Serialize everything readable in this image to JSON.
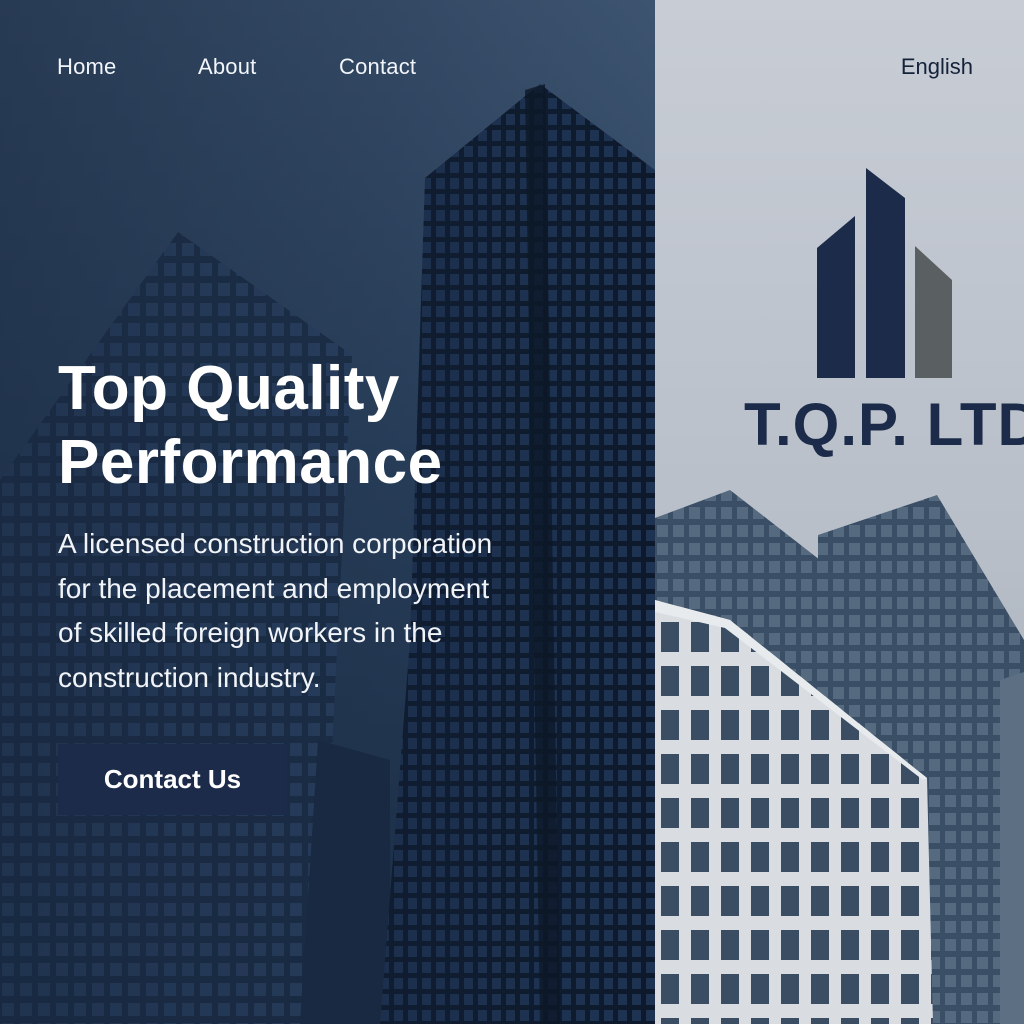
{
  "nav": {
    "links": [
      "Home",
      "About",
      "Contact"
    ],
    "language": "English"
  },
  "hero": {
    "title_line1": "Top Quality",
    "title_line2": "Performance",
    "subtitle_lines": [
      "A licensed construction corporation",
      "for the placement and employment",
      "of skilled foreign workers in the",
      "construction industry."
    ],
    "cta_label": "Contact Us"
  },
  "brand": {
    "name": "T.Q.P. LTD",
    "logo_icon": "buildings-logo-icon"
  },
  "colors": {
    "navy": "#1b2b49",
    "left_panel": "#2c435f",
    "right_panel": "#c0c6cf",
    "logo_gray": "#5a5f62"
  }
}
